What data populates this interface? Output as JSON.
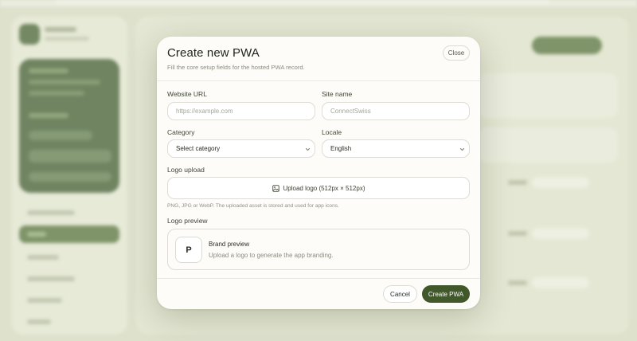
{
  "modal": {
    "title": "Create new PWA",
    "subtitle": "Fill the core setup fields for the hosted PWA record.",
    "close_label": "Close"
  },
  "form": {
    "website_url": {
      "label": "Website URL",
      "placeholder": "https://example.com",
      "value": ""
    },
    "site_name": {
      "label": "Site name",
      "placeholder": "ConnectSwiss",
      "value": ""
    },
    "category": {
      "label": "Category",
      "selected": "Select category"
    },
    "locale": {
      "label": "Locale",
      "selected": "English"
    },
    "logo_upload": {
      "label": "Logo upload",
      "button_label": "Upload logo (512px × 512px)",
      "hint": "PNG, JPG or WebP. The uploaded asset is stored and used for app icons.",
      "icon": "image-upload-icon"
    },
    "logo_preview": {
      "label": "Logo preview",
      "initial": "P",
      "title": "Brand preview",
      "description": "Upload a logo to generate the app branding."
    }
  },
  "footer": {
    "cancel_label": "Cancel",
    "create_label": "Create PWA"
  },
  "colors": {
    "accent": "#41582b",
    "background": "#dfe2cf",
    "modal_bg": "#fdfcf8"
  }
}
